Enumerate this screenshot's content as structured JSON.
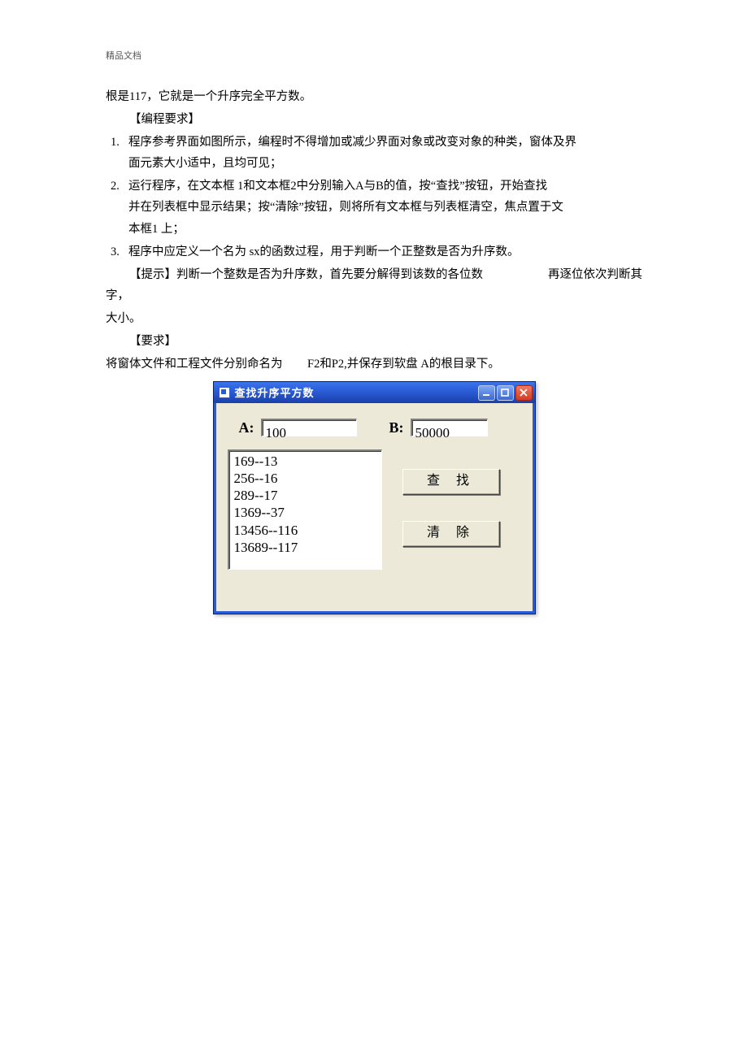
{
  "header": "精品文档",
  "body": {
    "intro": "根是117，它就是一个升序完全平方数。",
    "req_heading": "【编程要求】",
    "items": [
      {
        "num": "1.",
        "line1": "程序参考界面如图所示，编程时不得增加或减少界面对象或改变对象的种类，窗体及界",
        "line2": "面元素大小适中，且均可见；"
      },
      {
        "num": "2.",
        "line1": "运行程序，在文本框 1和文本框2中分别输入A与B的值，按“查找”按钮，开始查找",
        "line2": "并在列表框中显示结果；按“清除”按钮，则将所有文本框与列表框清空，焦点置于文",
        "line3": "本框1 上；"
      },
      {
        "num": "3.",
        "line1": "程序中应定义一个名为 sx的函数过程，用于判断一个正整数是否为升序数。"
      }
    ],
    "tip_left": "【提示】判断一个整数是否为升序数，首先要分解得到该数的各位数字，",
    "tip_right": "再逐位依次判断其",
    "tip_tail": "大小。",
    "yq_heading": "【要求】",
    "save_a": "将窗体文件和工程文件分别命名为",
    "save_b": "F2和P2,并保存到软盘 A的根目录下。"
  },
  "win": {
    "title": "查找升序平方数",
    "labelA": "A:",
    "labelB": "B:",
    "valA": "100",
    "valB": "50000",
    "list": [
      "169--13",
      "256--16",
      "289--17",
      "1369--37",
      "13456--116",
      "13689--117"
    ],
    "btn_find": "查 找",
    "btn_clear": "清 除"
  }
}
